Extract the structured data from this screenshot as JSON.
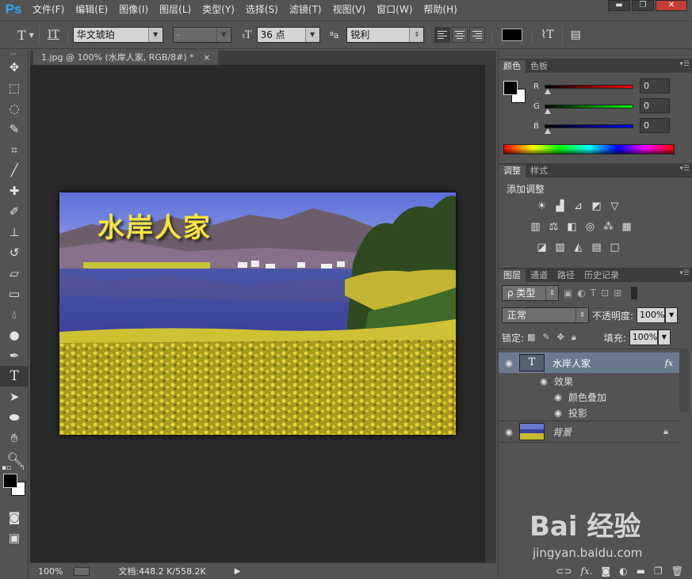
{
  "app": {
    "logo": "Ps"
  },
  "menu": [
    "文件(F)",
    "编辑(E)",
    "图像(I)",
    "图层(L)",
    "类型(Y)",
    "选择(S)",
    "滤镜(T)",
    "视图(V)",
    "窗口(W)",
    "帮助(H)"
  ],
  "window_controls": {
    "minimize": "▬",
    "restore": "❐",
    "close": "✕"
  },
  "options": {
    "font_family": "华文琥珀",
    "font_style": "-",
    "font_size": "36 点",
    "aa_label": "ªa",
    "aa_method": "锐利",
    "text_color": "#000000"
  },
  "document": {
    "tab_title": "1.jpg @ 100% (水岸人家, RGB/8#) *",
    "tab_close": "×",
    "image_text": "水岸人家",
    "text_color": "#f7e43b"
  },
  "status": {
    "zoom": "100%",
    "doc_size": "文档:448.2 K/558.2K"
  },
  "color_panel": {
    "tabs": [
      "颜色",
      "色板"
    ],
    "channels": [
      {
        "label": "R",
        "value": "0",
        "color": "#d21d1d"
      },
      {
        "label": "G",
        "value": "0",
        "color": "#1fb51f"
      },
      {
        "label": "B",
        "value": "0",
        "color": "#1f2bd3"
      }
    ],
    "foreground": "#000000",
    "background": "#ffffff"
  },
  "adjustments_panel": {
    "tabs": [
      "调整",
      "样式"
    ],
    "title": "添加调整",
    "row1": [
      "brightness-icon",
      "levels-icon",
      "curves-icon",
      "exposure-icon",
      "vibrance-icon"
    ],
    "row2": [
      "hue-saturation-icon",
      "color-balance-icon",
      "black-white-icon",
      "photo-filter-icon",
      "channel-mixer-icon",
      "color-lookup-icon"
    ],
    "row3": [
      "invert-icon",
      "posterize-icon",
      "threshold-icon",
      "gradient-map-icon",
      "selective-color-icon"
    ]
  },
  "layers_panel": {
    "tabs": [
      "图层",
      "通道",
      "路径",
      "历史记录"
    ],
    "filter": "ρ 类型",
    "blend_mode": "正常",
    "opacity_label": "不透明度:",
    "opacity": "100%",
    "lock_label": "锁定:",
    "fill_label": "填充:",
    "fill": "100%",
    "layers": [
      {
        "name": "水岸人家",
        "kind": "text",
        "fx": "fx",
        "thumb_glyph": "T"
      },
      {
        "name": "效果",
        "kind": "effects-group"
      },
      {
        "name": "颜色叠加",
        "kind": "effect"
      },
      {
        "name": "投影",
        "kind": "effect"
      },
      {
        "name": "背景",
        "kind": "background",
        "locked": true
      }
    ],
    "footer": [
      "link-icon",
      "fx-icon",
      "mask-icon",
      "adjustment-icon",
      "group-icon",
      "new-layer-icon",
      "delete-icon"
    ]
  },
  "watermark": {
    "logo": "Bai  经验",
    "url": "jingyan.baidu.com"
  }
}
